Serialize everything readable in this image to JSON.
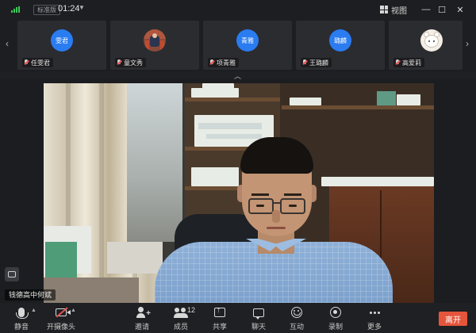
{
  "titlebar": {
    "badge": "标准版",
    "timer": "01:24",
    "view_label": "视图",
    "minimize": "—",
    "maximize": "☐",
    "close": "✕"
  },
  "participants": [
    {
      "name": "任雯君",
      "avatar_text": "雯君",
      "avatar_type": "initials",
      "avatar_color": "#2a7cf0"
    },
    {
      "name": "童文秀",
      "avatar_text": "",
      "avatar_type": "photo"
    },
    {
      "name": "项青雅",
      "avatar_text": "青雅",
      "avatar_type": "initials",
      "avatar_color": "#2a7cf0"
    },
    {
      "name": "王璐麟",
      "avatar_text": "璐麟",
      "avatar_type": "initials",
      "avatar_color": "#2a7cf0"
    },
    {
      "name": "高爱莉",
      "avatar_text": "",
      "avatar_type": "cartoon"
    }
  ],
  "main_video": {
    "speaker_name": "钱德高中何斌"
  },
  "toolbar": {
    "mute": "静音",
    "camera": "开摄像头",
    "invite": "邀请",
    "members": "成员",
    "member_count": "12",
    "share": "共享",
    "chat": "聊天",
    "interact": "互动",
    "record": "录制",
    "more": "更多",
    "leave": "离开"
  },
  "colors": {
    "accent": "#2a7cf0",
    "leave": "#e5553c",
    "signal": "#3ec85a",
    "muted": "#e65050"
  }
}
